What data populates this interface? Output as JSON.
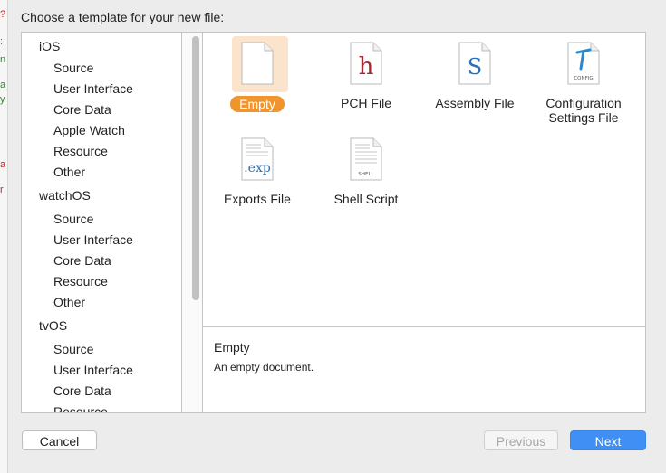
{
  "dialog": {
    "title": "Choose a template for your new file:"
  },
  "sidebar": {
    "rows": [
      {
        "label": "iOS",
        "kind": "plat"
      },
      {
        "label": "Source",
        "kind": "cat"
      },
      {
        "label": "User Interface",
        "kind": "cat"
      },
      {
        "label": "Core Data",
        "kind": "cat"
      },
      {
        "label": "Apple Watch",
        "kind": "cat"
      },
      {
        "label": "Resource",
        "kind": "cat"
      },
      {
        "label": "Other",
        "kind": "cat"
      },
      {
        "label": "watchOS",
        "kind": "plat"
      },
      {
        "label": "Source",
        "kind": "cat"
      },
      {
        "label": "User Interface",
        "kind": "cat"
      },
      {
        "label": "Core Data",
        "kind": "cat"
      },
      {
        "label": "Resource",
        "kind": "cat"
      },
      {
        "label": "Other",
        "kind": "cat"
      },
      {
        "label": "tvOS",
        "kind": "plat"
      },
      {
        "label": "Source",
        "kind": "cat"
      },
      {
        "label": "User Interface",
        "kind": "cat"
      },
      {
        "label": "Core Data",
        "kind": "cat"
      },
      {
        "label": "Resource",
        "kind": "cat"
      }
    ]
  },
  "templates": [
    {
      "label": "Empty",
      "icon": "blank-file-icon",
      "selected": true
    },
    {
      "label": "PCH File",
      "icon": "header-file-icon",
      "glyph": "h"
    },
    {
      "label": "Assembly File",
      "icon": "assembly-file-icon",
      "glyph": "S"
    },
    {
      "label": "Configuration Settings File",
      "icon": "config-file-icon",
      "glyph": "CONFIG"
    },
    {
      "label": "Exports File",
      "icon": "exports-file-icon",
      "glyph": ".exp"
    },
    {
      "label": "Shell Script",
      "icon": "shell-script-icon",
      "glyph": "SHELL"
    }
  ],
  "description": {
    "title": "Empty",
    "text": "An empty document."
  },
  "buttons": {
    "cancel": "Cancel",
    "previous": "Previous",
    "next": "Next"
  },
  "colors": {
    "accent": "#3f8ff5",
    "selection": "#f0952e",
    "selection_bg": "#fbe3cc"
  }
}
